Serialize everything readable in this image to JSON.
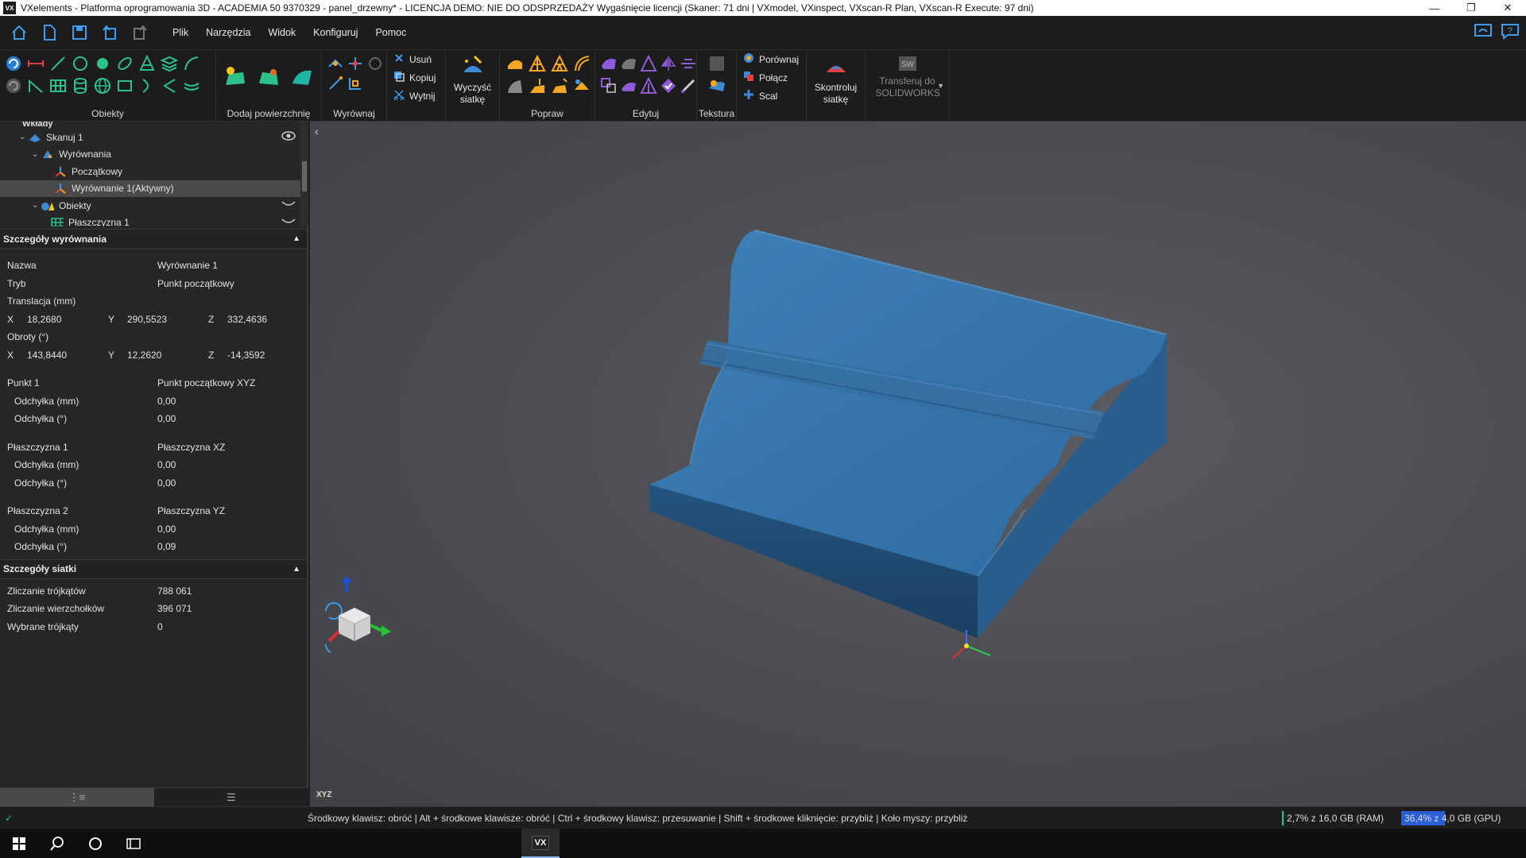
{
  "window": {
    "app_icon": "VX",
    "title": "VXelements - Platforma oprogramowania 3D - ACADEMIA 50 9370329 - panel_drzewny* - LICENCJA DEMO: NIE DO ODSPRZEDAŻY Wygaśnięcie licencji (Skaner: 71 dni | VXmodel, VXinspect, VXscan-R Plan, VXscan-R Execute: 97 dni)",
    "controls": [
      "minimize",
      "restore",
      "close"
    ]
  },
  "menu": {
    "items": [
      "Plik",
      "Narzędzia",
      "Widok",
      "Konfiguruj",
      "Pomoc"
    ]
  },
  "ribbon": {
    "groups": {
      "obiekty": "Obiekty",
      "dodaj_powierzchnie": "Dodaj powierzchnię",
      "wyrownaj": "Wyrównaj",
      "popraw": "Popraw",
      "edytuj": "Edytuj",
      "tekstura": "Tekstura"
    },
    "edit_actions": {
      "usun": "Usuń",
      "kopiuj": "Kopiuj",
      "wytnij": "Wytnij"
    },
    "clean_mesh": "Wyczyść siatkę",
    "compare": {
      "porownaj": "Porównaj",
      "polacz": "Połącz",
      "scal": "Scal"
    },
    "check_mesh": "Skontroluj siatkę",
    "transfer": "Transferuj do SOLIDWORKS"
  },
  "tree": {
    "partial_top": "Wkłady",
    "items": [
      {
        "label": "Skanuj 1",
        "level": 1
      },
      {
        "label": "Wyrównania",
        "level": 2
      },
      {
        "label": "Początkowy",
        "level": 3
      },
      {
        "label": "Wyrównanie 1(Aktywny)",
        "level": 3,
        "selected": true
      },
      {
        "label": "Obiekty",
        "level": 2
      },
      {
        "label": "Płaszczyzna 1",
        "level": 3
      }
    ]
  },
  "alignment_details": {
    "header": "Szczegóły wyrównania",
    "name_label": "Nazwa",
    "name_value": "Wyrównanie 1",
    "mode_label": "Tryb",
    "mode_value": "Punkt początkowy",
    "translation_label": "Translacja (mm)",
    "translation": {
      "x_label": "X",
      "x": "18,2680",
      "y_label": "Y",
      "y": "290,5523",
      "z_label": "Z",
      "z": "332,4636"
    },
    "rotation_label": "Obroty (°)",
    "rotation": {
      "x_label": "X",
      "x": "143,8440",
      "y_label": "Y",
      "y": "12,2620",
      "z_label": "Z",
      "z": "-14,3592"
    },
    "point1_label": "Punkt 1",
    "point1_value": "Punkt początkowy XYZ",
    "dev_mm_label": "Odchyłka (mm)",
    "dev_deg_label": "Odchyłka (°)",
    "point1_dev_mm": "0,00",
    "point1_dev_deg": "0,00",
    "plane1_label": "Płaszczyzna 1",
    "plane1_value": "Płaszczyzna XZ",
    "plane1_dev_mm": "0,00",
    "plane1_dev_deg": "0,00",
    "plane2_label": "Płaszczyzna 2",
    "plane2_value": "Płaszczyzna YZ",
    "plane2_dev_mm": "0,00",
    "plane2_dev_deg": "0,09"
  },
  "mesh_details": {
    "header": "Szczegóły siatki",
    "triangles_label": "Zliczanie trójkątów",
    "triangles": "788 061",
    "vertices_label": "Zliczanie wierzchołków",
    "vertices": "396 071",
    "selected_label": "Wybrane trójkąty",
    "selected": "0"
  },
  "viewport": {
    "axis_label": "XYZ",
    "mesh_color": "#2f6ea3",
    "background": "#4d4f55"
  },
  "status": {
    "hint": "Środkowy klawisz: obróć  |  Alt + środkowe klawisze: obróć  |  Ctrl + środkowy klawisz: przesuwanie  |  Shift + środkowe kliknięcie: przybliż  |  Koło myszy: przybliż",
    "ram": "2,7% z 16,0 GB (RAM)",
    "ram_fraction": 0.027,
    "gpu": "36,4% z 4,0 GB (GPU)",
    "gpu_fraction": 0.364
  },
  "taskbar": {
    "items": [
      "windows-start",
      "search",
      "cortana",
      "task-view",
      "vxelements"
    ],
    "vx_label": "VX"
  }
}
